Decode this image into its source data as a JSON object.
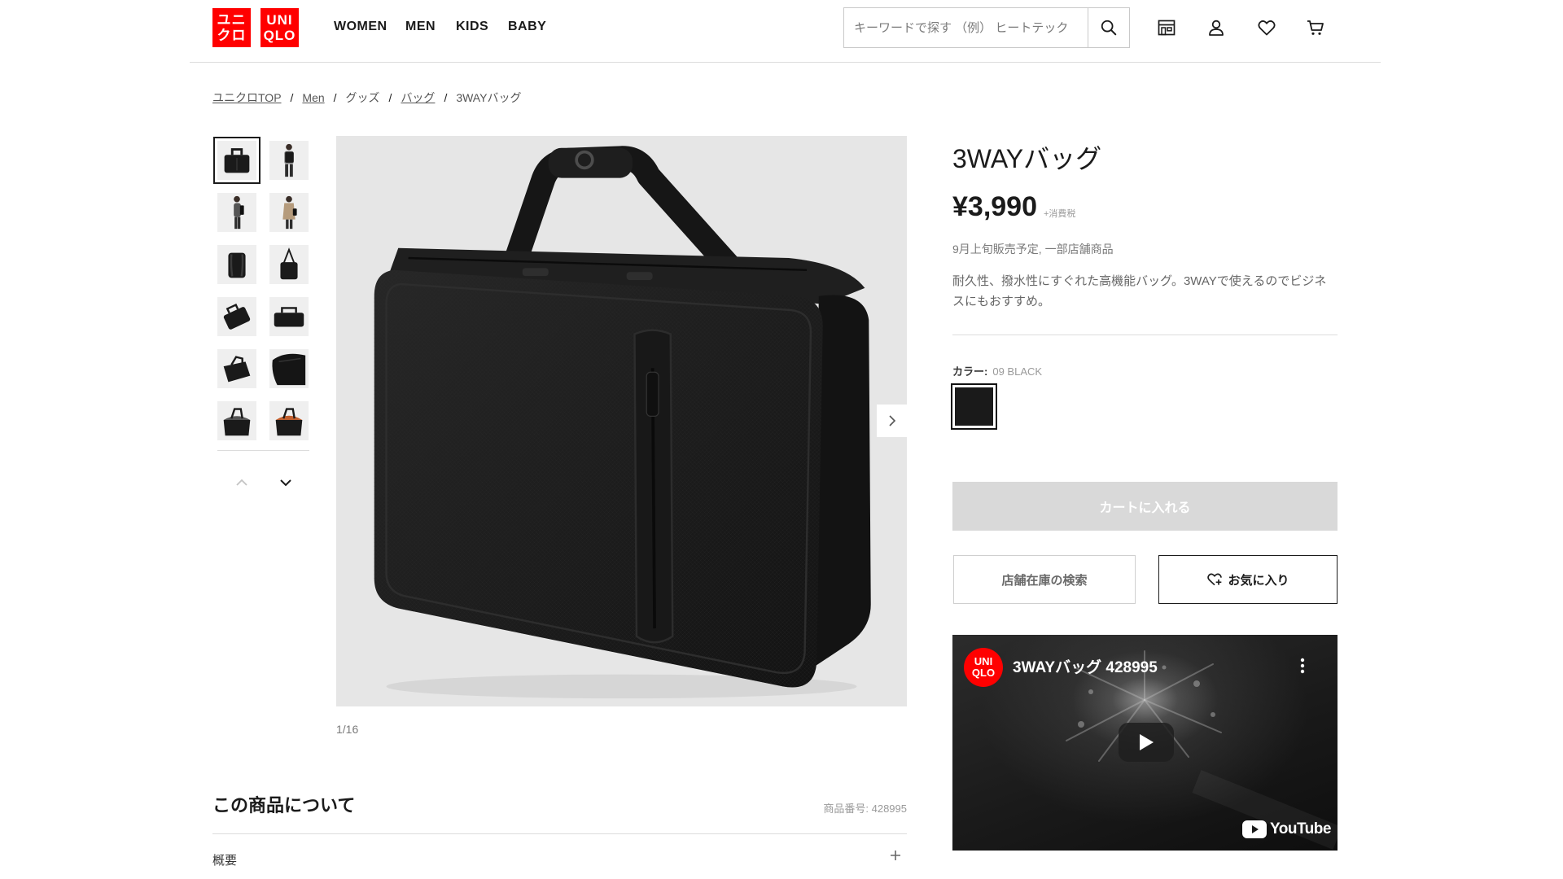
{
  "header": {
    "logo": {
      "jp_top": "ユニ",
      "jp_bottom": "クロ",
      "en_top": "UNI",
      "en_bottom": "QLO"
    },
    "nav": [
      "WOMEN",
      "MEN",
      "KIDS",
      "BABY"
    ],
    "search_placeholder": "キーワードで探す （例） ヒートテック",
    "icons": [
      "search-icon",
      "store-icon",
      "user-icon",
      "heart-icon",
      "cart-icon"
    ]
  },
  "breadcrumb": [
    {
      "label": "ユニクロTOP",
      "link": true
    },
    {
      "label": "Men",
      "link": true
    },
    {
      "label": "グッズ",
      "link": false
    },
    {
      "label": "バッグ",
      "link": true
    },
    {
      "label": "3WAYバッグ",
      "link": false
    }
  ],
  "breadcrumb_separator": "/",
  "gallery": {
    "thumbnails": [
      "briefcase-front",
      "model-with-backpack",
      "model-side-view",
      "model-beige-coat",
      "backpack-back",
      "shoulder-bag",
      "bag-tilted",
      "bag-side",
      "bag-angle",
      "bag-detail",
      "bag-open",
      "bag-open-lining"
    ],
    "selected_index": 0,
    "counter": "1/16"
  },
  "product": {
    "title": "3WAYバッグ",
    "price": "¥3,990",
    "tax_note": "+消費税",
    "availability": "9月上旬販売予定, 一部店舗商品",
    "description": "耐久性、撥水性にすぐれた高機能バッグ。3WAYで使えるのでビジネスにもおすすめ。",
    "color_label": "カラー:",
    "color_value": "09 BLACK",
    "cart_button": "カートに入れる",
    "store_button": "店舗在庫の検索",
    "favorite_button": "お気に入り"
  },
  "about": {
    "heading": "この商品について",
    "product_number": "商品番号: 428995",
    "section": "概要"
  },
  "video": {
    "logo_top": "UNI",
    "logo_bottom": "QLO",
    "title": "3WAYバッグ 428995",
    "youtube_label": "YouTube"
  },
  "colors": {
    "brand_red": "#ff0000",
    "swatch_black": "#1a1a1a",
    "cart_disabled": "#d9d9d9"
  }
}
